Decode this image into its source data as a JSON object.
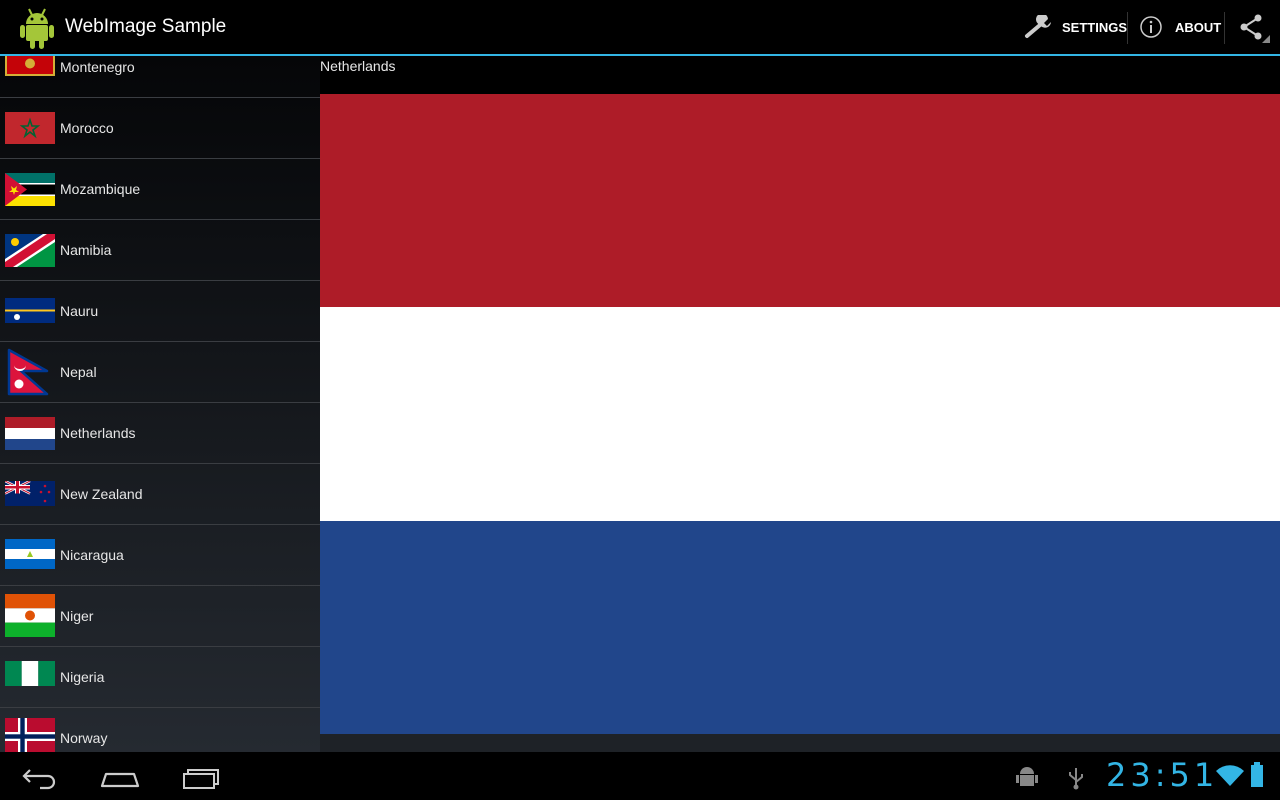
{
  "app": {
    "title": "WebImage Sample"
  },
  "actions": {
    "settings_label": "SETTINGS",
    "about_label": "ABOUT",
    "share_icon": "share-icon"
  },
  "list": {
    "items": [
      {
        "label": "Montenegro",
        "flag": "montenegro"
      },
      {
        "label": "Morocco",
        "flag": "morocco"
      },
      {
        "label": "Mozambique",
        "flag": "mozambique"
      },
      {
        "label": "Namibia",
        "flag": "namibia"
      },
      {
        "label": "Nauru",
        "flag": "nauru"
      },
      {
        "label": "Nepal",
        "flag": "nepal"
      },
      {
        "label": "Netherlands",
        "flag": "netherlands"
      },
      {
        "label": "New Zealand",
        "flag": "new-zealand"
      },
      {
        "label": "Nicaragua",
        "flag": "nicaragua"
      },
      {
        "label": "Niger",
        "flag": "niger"
      },
      {
        "label": "Nigeria",
        "flag": "nigeria"
      },
      {
        "label": "Norway",
        "flag": "norway"
      }
    ]
  },
  "detail": {
    "title": "Netherlands",
    "colors": [
      "#ae1c28",
      "#ffffff",
      "#21468b"
    ]
  },
  "statusbar": {
    "time": "23:51"
  },
  "colors": {
    "accent": "#33b5e5"
  }
}
